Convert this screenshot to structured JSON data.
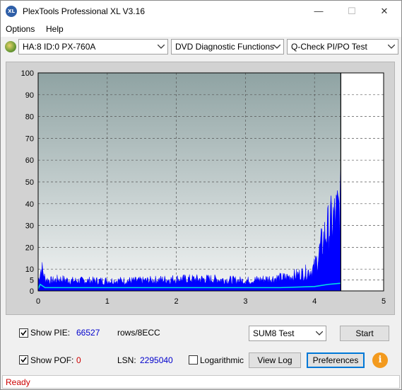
{
  "window": {
    "title": "PlexTools Professional XL V3.16",
    "app_icon_text": "XL",
    "minimize_glyph": "—",
    "maximize_glyph": "☐",
    "close_glyph": "✕"
  },
  "menu": {
    "options": "Options",
    "help": "Help"
  },
  "toolbar": {
    "drive": "HA:8 ID:0  PX-760A",
    "function": "DVD Diagnostic Functions",
    "test": "Q-Check PI/PO Test"
  },
  "chart_data": {
    "type": "area",
    "x_ticks": [
      "0",
      "1",
      "2",
      "3",
      "4",
      "5"
    ],
    "y_ticks": [
      "0",
      "5",
      "10",
      "20",
      "30",
      "40",
      "50",
      "60",
      "70",
      "80",
      "90",
      "100"
    ],
    "xlim": [
      0,
      5
    ],
    "ylim": [
      0,
      100
    ],
    "grid": true,
    "end_marker_x": 4.38,
    "series": [
      {
        "color": "#0000ff",
        "x": [
          0.0,
          0.05,
          0.1,
          0.2,
          0.3,
          0.5,
          0.7,
          1.0,
          1.5,
          2.0,
          2.5,
          3.0,
          3.3,
          3.6,
          3.8,
          3.95,
          4.0,
          4.05,
          4.1,
          4.15,
          4.2,
          4.25,
          4.3,
          4.35,
          4.38
        ],
        "values": [
          6,
          14,
          7,
          6,
          7,
          6,
          6,
          6,
          6,
          7,
          7,
          6,
          7,
          8,
          10,
          12,
          14,
          20,
          27,
          33,
          37,
          41,
          44,
          48,
          52
        ]
      },
      {
        "color": "#00e0e0",
        "x": [
          0.0,
          0.03,
          0.1,
          0.5,
          1.0,
          2.0,
          3.0,
          3.5,
          4.0,
          4.2,
          4.38
        ],
        "values": [
          1,
          3,
          1.5,
          1.5,
          1.5,
          1.5,
          1.5,
          1.5,
          2,
          3,
          3.5
        ]
      }
    ]
  },
  "controls": {
    "show_pie_label": "Show PIE:",
    "show_pie_value": "66527",
    "rows_label": "rows/8ECC",
    "show_pof_label": "Show POF:",
    "show_pof_value": "0",
    "lsn_label": "LSN:",
    "lsn_value": "2295040",
    "logarithmic_label": "Logarithmic",
    "test_select": "SUM8 Test",
    "start_button": "Start",
    "view_log_button": "View Log",
    "preferences_button": "Preferences",
    "info_glyph": "i",
    "show_pie_checked": true,
    "show_pof_checked": true,
    "logarithmic_checked": false
  },
  "status": {
    "text": "Ready"
  }
}
